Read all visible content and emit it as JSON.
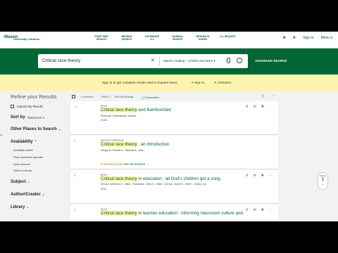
{
  "header": {
    "logo_mark": "Mason",
    "logo_sub": "University Libraries",
    "nav": [
      "START NEW SEARCH",
      "BROWSE SEARCH",
      "DATABASES A-Z",
      "JOURNAL SEARCH",
      "RESEARCH GUIDES",
      "ILL REQUEST"
    ],
    "sign_in": "Sign-in",
    "menu": "Menu"
  },
  "search": {
    "query": "Critical race theory",
    "scope": "Mason Catalog + Articles and More",
    "advanced": "ADVANCED SEARCH"
  },
  "banner": {
    "message": "Sign in to get complete results and to request items",
    "sign_in": "Sign in",
    "dismiss": "DISMISS"
  },
  "sidebar": {
    "title": "Refine your Results",
    "expand": "Expand My Results",
    "sort_label": "Sort by",
    "sort_value": "Relevance",
    "other_places": "Other Places to Search",
    "availability": "Availability",
    "availability_items": [
      "Available online",
      "Peer-reviewed Journals",
      "Open Access",
      "Held at Library"
    ],
    "subject": "Subject",
    "author": "Author/Creator",
    "library": "Library"
  },
  "results": {
    "selected": "0 selected",
    "page_label": "PAGE 1",
    "count": "780,456 Results",
    "personalize": "Personalize",
    "items": [
      {
        "num": "",
        "type": "BOOK",
        "title": "Critical race theory and Bamboozled",
        "line1": "Ruiengo, Aleksandra, author.",
        "line2": "2018",
        "avail": ""
      },
      {
        "num": "2",
        "type": "MULTIPLE VERSIONS",
        "title": "Critical race theory : an introduction",
        "line1": "Delgado, Richard ; Stefancic, Jean",
        "line2": "",
        "avail": "2 versions found",
        "avail2": "See all versions"
      },
      {
        "num": "3",
        "type": "BOOK",
        "title": "Critical race theory in education : all God's children got a song",
        "line1": "Dixson, Adrienne D., editor ; Rousseau, Celia K., editor ; Donnor, Jamel K., editor ; Library, Inc.",
        "line2": "2021",
        "avail": ""
      },
      {
        "num": "4",
        "type": "BOOK",
        "title": "Critical race theory in teacher education : informing classroom culture and",
        "line1": "",
        "line2": "",
        "avail": ""
      }
    ]
  },
  "pager": {
    "label": "PAGE",
    "number": "1"
  }
}
